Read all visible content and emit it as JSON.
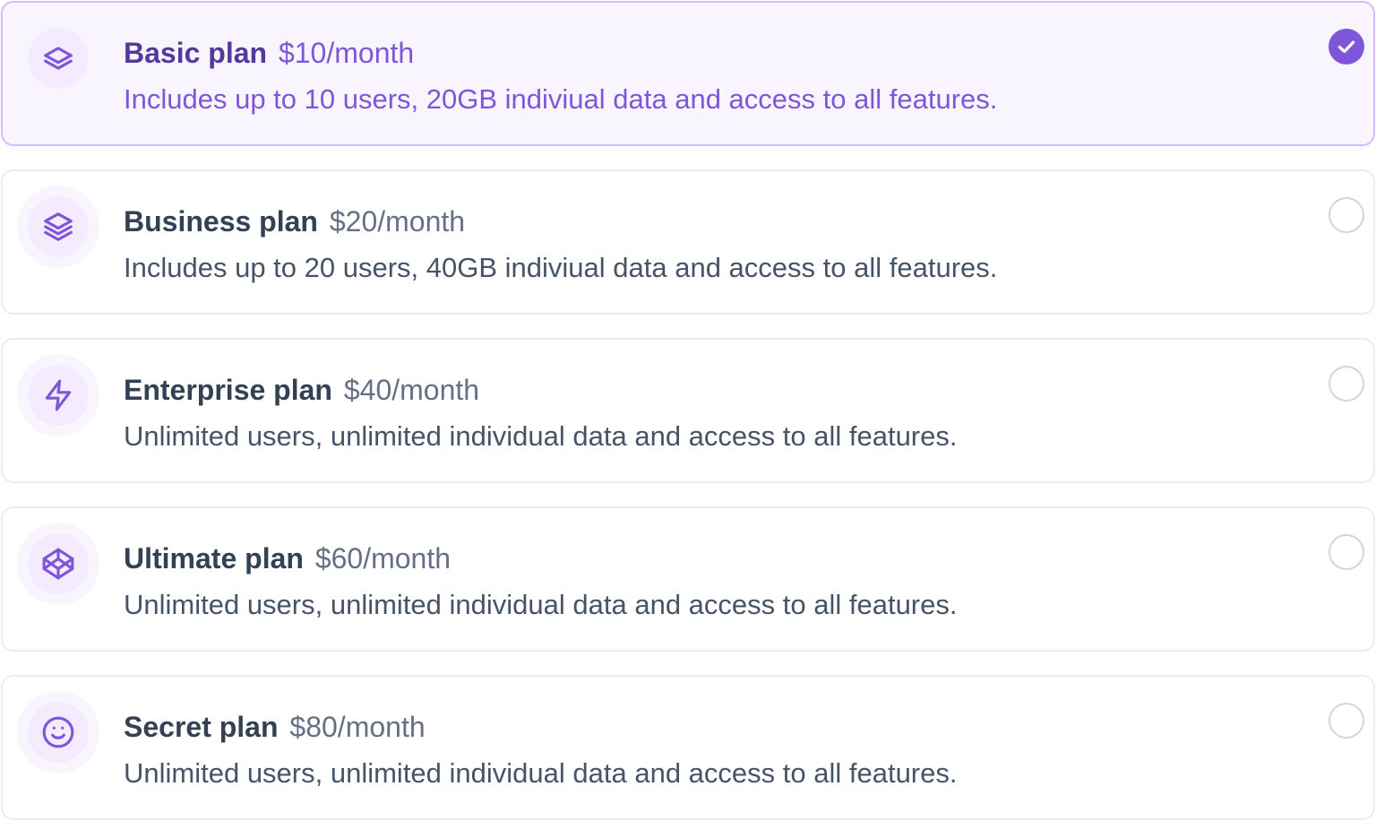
{
  "plans": [
    {
      "name": "Basic plan",
      "price": "$10/month",
      "description": "Includes up to 10 users, 20GB indiviual data and access to all features.",
      "icon": "layers-two-icon",
      "selected": true
    },
    {
      "name": "Business plan",
      "price": "$20/month",
      "description": "Includes up to 20 users, 40GB indiviual data and access to all features.",
      "icon": "layers-three-icon",
      "selected": false
    },
    {
      "name": "Enterprise plan",
      "price": "$40/month",
      "description": "Unlimited users, unlimited individual data and access to all features.",
      "icon": "zap-icon",
      "selected": false
    },
    {
      "name": "Ultimate plan",
      "price": "$60/month",
      "description": "Unlimited users, unlimited individual data and access to all features.",
      "icon": "codepen-icon",
      "selected": false
    },
    {
      "name": "Secret plan",
      "price": "$80/month",
      "description": "Unlimited users, unlimited individual data and access to all features.",
      "icon": "smile-icon",
      "selected": false
    }
  ],
  "colors": {
    "accent": "#7f56d9",
    "accent_dark": "#53389e",
    "selected_bg": "#f9f5ff",
    "selected_border": "#d6bbfb",
    "border": "#eaecf0",
    "text_primary": "#344054",
    "text_secondary": "#475467"
  }
}
